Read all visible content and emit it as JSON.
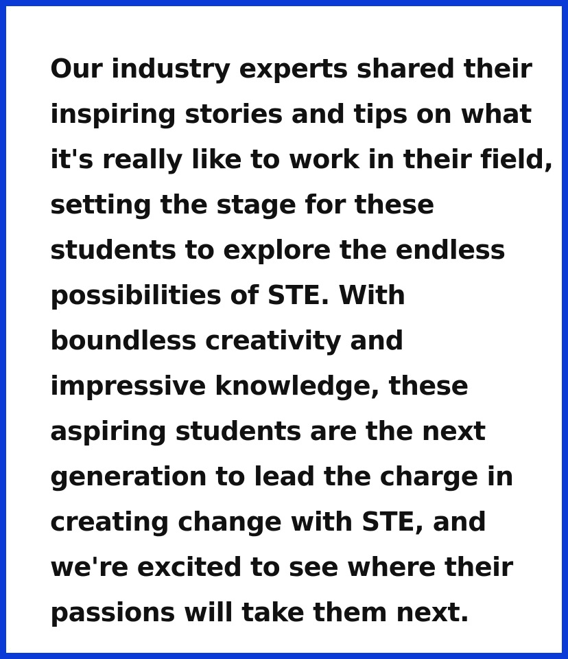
{
  "colors": {
    "border": "#0a3bd6",
    "background": "#ffffff",
    "text": "#111111"
  },
  "paragraph": {
    "lines": [
      "Our industry experts shared their",
      "inspiring stories and tips on what",
      "it's really like to work in their field,",
      "setting the stage for these",
      "students to explore the endless",
      "possibilities of STE. With",
      "boundless creativity and",
      "impressive knowledge, these",
      "aspiring students are the next",
      "generation to lead the charge in",
      "creating change with STE, and",
      "we're excited to see where their",
      "passions will take them next."
    ]
  }
}
